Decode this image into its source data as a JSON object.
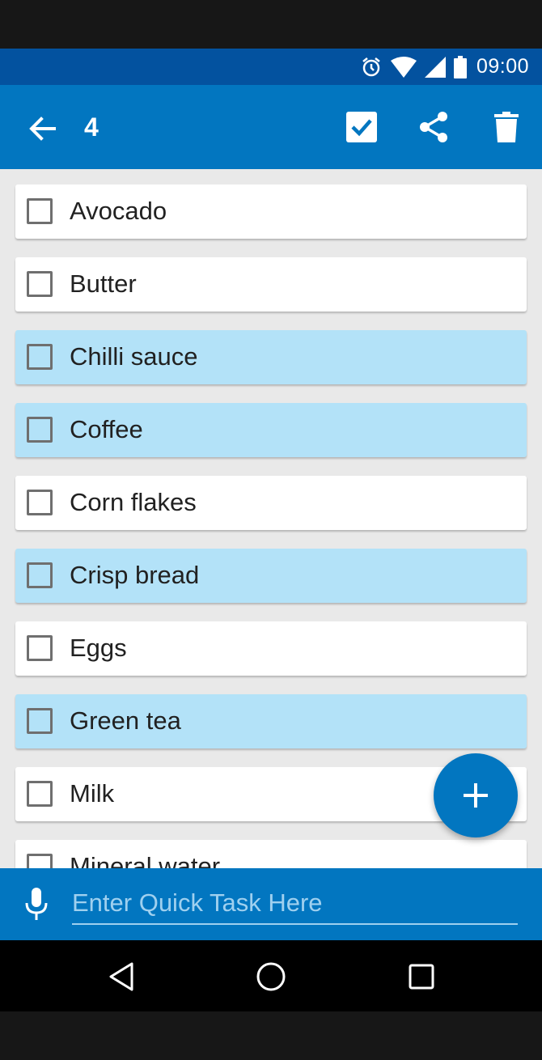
{
  "status_bar": {
    "time": "09:00",
    "icons": [
      "alarm-icon",
      "wifi-icon",
      "signal-icon",
      "battery-icon"
    ]
  },
  "app_bar": {
    "title": "4",
    "icons": [
      "back-arrow-icon",
      "checkbox-checked-icon",
      "share-icon",
      "trash-icon"
    ]
  },
  "colors": {
    "status_bar": "#03529f",
    "app_bar": "#0276c0",
    "highlight_item": "#b3e2f8",
    "background": "#e9e9e9"
  },
  "items": [
    {
      "label": "Avocado",
      "highlighted": false
    },
    {
      "label": "Butter",
      "highlighted": false
    },
    {
      "label": "Chilli sauce",
      "highlighted": true
    },
    {
      "label": "Coffee",
      "highlighted": true
    },
    {
      "label": "Corn flakes",
      "highlighted": false
    },
    {
      "label": "Crisp bread",
      "highlighted": true
    },
    {
      "label": "Eggs",
      "highlighted": false
    },
    {
      "label": "Green tea",
      "highlighted": true
    },
    {
      "label": "Milk",
      "highlighted": false
    },
    {
      "label": "Mineral water",
      "highlighted": false
    }
  ],
  "fab": {
    "icon": "plus-icon"
  },
  "quick_task": {
    "placeholder": "Enter Quick Task Here",
    "icon": "mic-icon"
  },
  "nav_bar": {
    "icons": [
      "back-triangle-icon",
      "home-circle-icon",
      "recents-square-icon"
    ]
  }
}
